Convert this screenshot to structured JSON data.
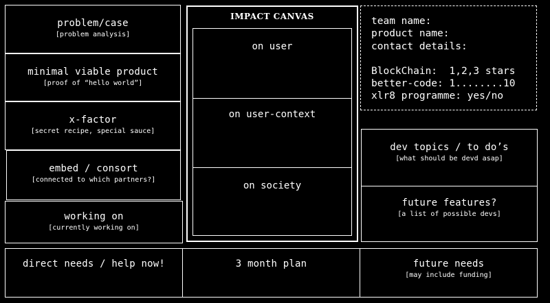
{
  "left_column": [
    {
      "title": "problem/case",
      "subtitle": "[problem analysis]"
    },
    {
      "title": "minimal viable product",
      "subtitle": "[proof of “hello world”]"
    },
    {
      "title": "x-factor",
      "subtitle": "[secret recipe, special sauce]"
    },
    {
      "title": "embed / consort",
      "subtitle": "[connected to which partners?]"
    },
    {
      "title": "working on",
      "subtitle": "[currently working on]"
    }
  ],
  "impact_canvas": {
    "heading": "IMPACT CANVAS",
    "sections": [
      "on user",
      "on user-context",
      "on society"
    ]
  },
  "info_panel": {
    "lines_top": [
      "team name:",
      "product name:",
      "contact details:"
    ],
    "lines_bottom": [
      "BlockChain:  1,2,3 stars",
      "better-code: 1........10",
      "xlr8 programme: yes/no"
    ]
  },
  "right_column": [
    {
      "title": "dev topics / to do’s",
      "subtitle": "[what should be devd asap]"
    },
    {
      "title": "future features?",
      "subtitle": "[a list of possible devs]"
    }
  ],
  "bottom_row": [
    {
      "title": "direct needs / help now!",
      "subtitle": ""
    },
    {
      "title": "3 month plan",
      "subtitle": ""
    },
    {
      "title": "future needs",
      "subtitle": "[may include funding]"
    }
  ]
}
